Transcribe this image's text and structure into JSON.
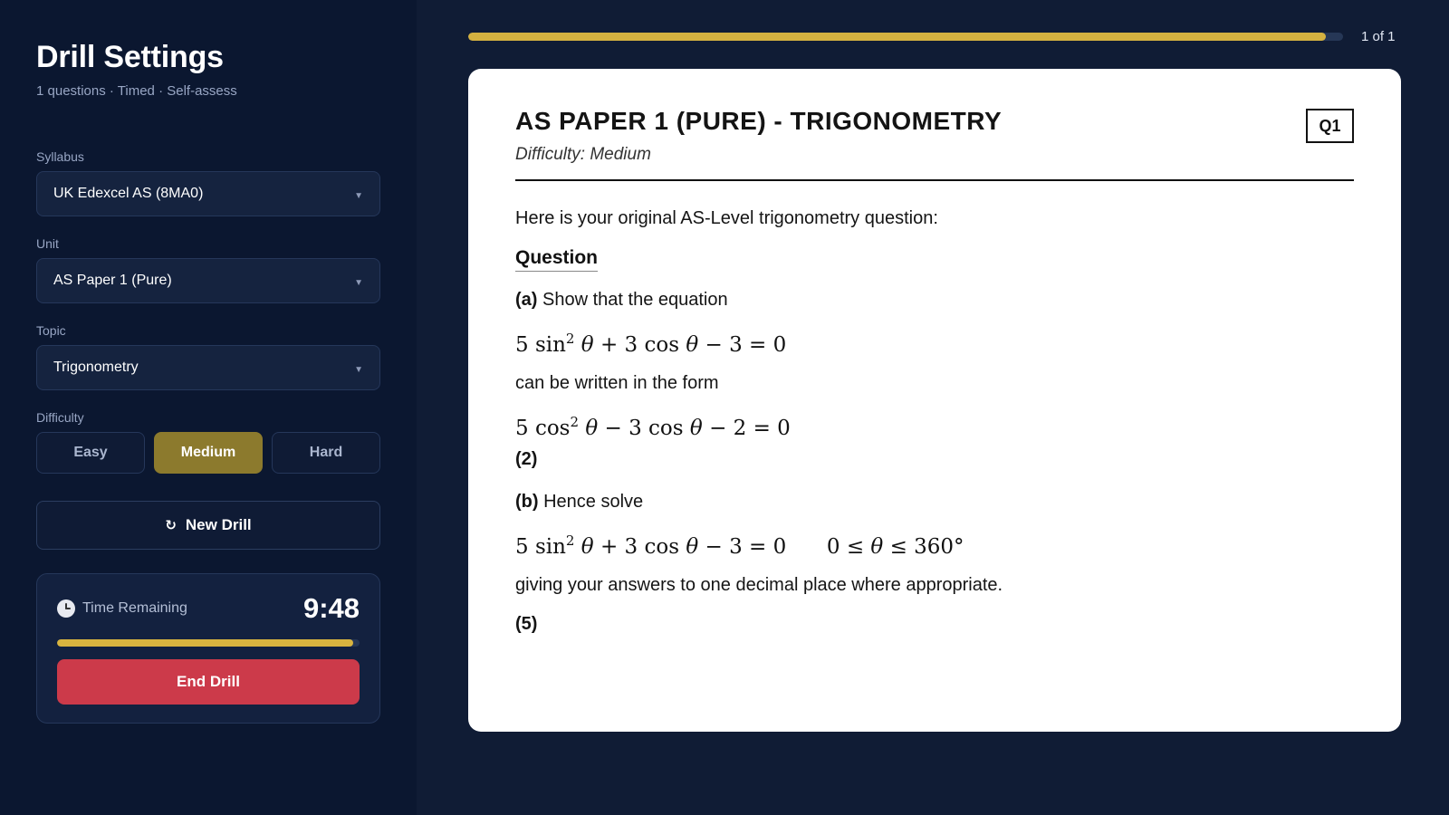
{
  "sidebar": {
    "title": "Drill Settings",
    "subtitle": "1 questions · Timed · Self-assess",
    "syllabus": {
      "label": "Syllabus",
      "value": "UK Edexcel AS (8MA0)"
    },
    "unit": {
      "label": "Unit",
      "value": "AS Paper 1 (Pure)"
    },
    "topic": {
      "label": "Topic",
      "value": "Trigonometry"
    },
    "difficulty": {
      "label": "Difficulty",
      "options": [
        "Easy",
        "Medium",
        "Hard"
      ],
      "selected": "Medium"
    },
    "new_drill": {
      "icon": "↻",
      "label": "New Drill"
    },
    "timer": {
      "label": "Time Remaining",
      "value": "9:48",
      "remaining_fraction": 0.98,
      "end_label": "End Drill"
    }
  },
  "progress": {
    "text": "1 of 1",
    "fraction": 0.98
  },
  "card": {
    "title": "AS PAPER 1 (PURE) - TRIGONOMETRY",
    "difficulty": "Difficulty: Medium",
    "badge": "Q1",
    "intro": "Here is your original AS-Level trigonometry question:",
    "heading": "Question",
    "part_a_label": "(a)",
    "part_a_text": "Show that the equation",
    "eq1": {
      "a": "5 sin",
      "b": "θ",
      "c": "+ 3 cos",
      "d": "θ",
      "e": "− 3 = 0"
    },
    "form_text": "can be written in the form",
    "eq2": {
      "a": "5 cos",
      "b": "θ",
      "c": "− 3 cos",
      "d": "θ",
      "e": "− 2 = 0"
    },
    "marks_a": "(2)",
    "part_b_label": "(b)",
    "part_b_text": "Hence solve",
    "eq3": {
      "a": "5 sin",
      "b": "θ",
      "c": "+ 3 cos",
      "d": "θ",
      "e": "− 3 = 0",
      "range_a": "0 ≤",
      "range_b": "θ",
      "range_c": "≤ 360°"
    },
    "answer_text": "giving your answers to one decimal place where appropriate.",
    "marks_b": "(5)",
    "superscript": "2"
  },
  "colors": {
    "accent_gold": "#d4b140",
    "medium_active": "#8c7a2d",
    "end_red": "#cc3a4a",
    "sidebar_bg": "#0b1730",
    "main_bg": "#101c35"
  },
  "icons": {
    "timer": "clock-icon",
    "new_drill": "refresh-icon",
    "select": "chevron-down-icon"
  }
}
